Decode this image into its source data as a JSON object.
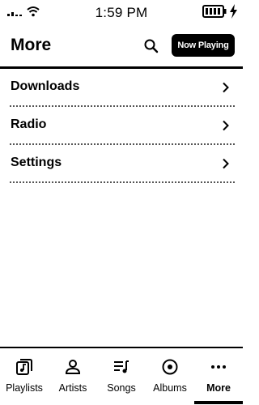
{
  "status_bar": {
    "time": "1:59 PM",
    "icons": [
      "signal-icon",
      "wifi-icon",
      "battery-icon",
      "charging-bolt-icon"
    ]
  },
  "header": {
    "title": "More",
    "search_icon": "search-icon",
    "now_playing_label": "Now Playing"
  },
  "menu": {
    "items": [
      {
        "label": "Downloads",
        "icon": "chevron-right-icon"
      },
      {
        "label": "Radio",
        "icon": "chevron-right-icon"
      },
      {
        "label": "Settings",
        "icon": "chevron-right-icon"
      }
    ]
  },
  "tab_bar": {
    "active": "More",
    "tabs": [
      {
        "label": "Playlists",
        "icon": "playlist-music-icon"
      },
      {
        "label": "Artists",
        "icon": "person-icon"
      },
      {
        "label": "Songs",
        "icon": "queue-music-icon"
      },
      {
        "label": "Albums",
        "icon": "album-disc-icon"
      },
      {
        "label": "More",
        "icon": "more-dots-icon"
      }
    ]
  }
}
